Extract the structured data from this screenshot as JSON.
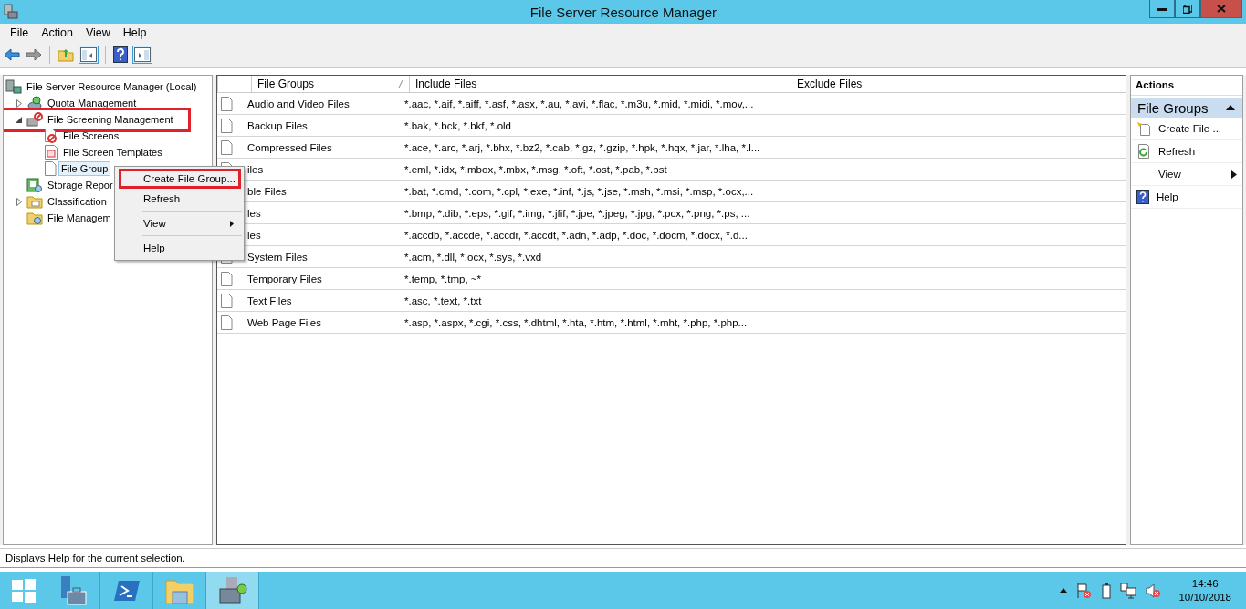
{
  "window": {
    "title": "File Server Resource Manager"
  },
  "menu": [
    "File",
    "Action",
    "View",
    "Help"
  ],
  "tree": {
    "label": "File Server Resource Manager (Local)",
    "kind": "server",
    "children": [
      {
        "label": "Quota Management",
        "kind": "quota",
        "expanded": false
      },
      {
        "label": "File Screening Management",
        "kind": "screening",
        "expanded": true,
        "annotated": true,
        "children": [
          {
            "label": "File Screens",
            "kind": "screens",
            "selected": false
          },
          {
            "label": "File Screen Templates",
            "kind": "templates",
            "selected": false
          },
          {
            "label": "File Group",
            "kind": "groups",
            "selected": true
          }
        ]
      },
      {
        "label": "Storage Repor",
        "kind": "reports"
      },
      {
        "label": "Classification",
        "kind": "classification",
        "expanded": false
      },
      {
        "label": "File Managem",
        "kind": "management"
      }
    ]
  },
  "table": {
    "columns": [
      "File Groups",
      "Include Files",
      "Exclude Files"
    ],
    "rows": [
      {
        "name": "Audio and Video Files",
        "include": "*.aac, *.aif, *.aiff, *.asf, *.asx, *.au, *.avi, *.flac, *.m3u, *.mid, *.midi, *.mov,..."
      },
      {
        "name": "Backup Files",
        "include": "*.bak, *.bck, *.bkf, *.old"
      },
      {
        "name": "Compressed Files",
        "include": "*.ace, *.arc, *.arj, *.bhx, *.bz2, *.cab, *.gz, *.gzip, *.hpk, *.hqx, *.jar, *.lha, *.l..."
      },
      {
        "name": "iles",
        "include": "*.eml, *.idx, *.mbox, *.mbx, *.msg, *.oft, *.ost, *.pab, *.pst"
      },
      {
        "name": "ble Files",
        "include": "*.bat, *.cmd, *.com, *.cpl, *.exe, *.inf, *.js, *.jse, *.msh, *.msi, *.msp, *.ocx,..."
      },
      {
        "name": "les",
        "include": "*.bmp, *.dib, *.eps, *.gif, *.img, *.jfif, *.jpe, *.jpeg, *.jpg, *.pcx, *.png, *.ps, ..."
      },
      {
        "name": "les",
        "include": "*.accdb, *.accde, *.accdr, *.accdt, *.adn, *.adp, *.doc, *.docm, *.docx, *.d..."
      },
      {
        "name": "System Files",
        "include": "*.acm, *.dll, *.ocx, *.sys, *.vxd"
      },
      {
        "name": "Temporary Files",
        "include": "*.temp, *.tmp, ~*"
      },
      {
        "name": "Text Files",
        "include": "*.asc, *.text, *.txt"
      },
      {
        "name": "Web Page Files",
        "include": "*.asp, *.aspx, *.cgi, *.css, *.dhtml, *.hta, *.htm, *.html, *.mht, *.php, *.php..."
      }
    ]
  },
  "context_menu": {
    "items": [
      {
        "kind": "item",
        "label": "Create File Group...",
        "annotated": true
      },
      {
        "kind": "item",
        "label": "Refresh",
        "annotated": false
      },
      {
        "kind": "separator"
      },
      {
        "kind": "submenu",
        "label": "View",
        "annotated": false
      },
      {
        "kind": "separator"
      },
      {
        "kind": "item",
        "label": "Help",
        "annotated": false
      }
    ]
  },
  "actions": {
    "title": "Actions",
    "section": "File Groups",
    "items": [
      {
        "kind": "create",
        "label": "Create File ..."
      },
      {
        "kind": "refresh",
        "label": "Refresh"
      },
      {
        "kind": "submenu",
        "label": "View"
      },
      {
        "kind": "help",
        "label": "Help"
      }
    ]
  },
  "status_bar": "Displays Help for the current selection.",
  "taskbar": {
    "apps": [
      {
        "kind": "start",
        "selected": false
      },
      {
        "kind": "server-manager",
        "selected": false
      },
      {
        "kind": "powershell",
        "selected": false
      },
      {
        "kind": "explorer",
        "selected": false
      },
      {
        "kind": "fsrm",
        "selected": true
      }
    ],
    "clock": {
      "time": "14:46",
      "date": "10/10/2018"
    }
  }
}
